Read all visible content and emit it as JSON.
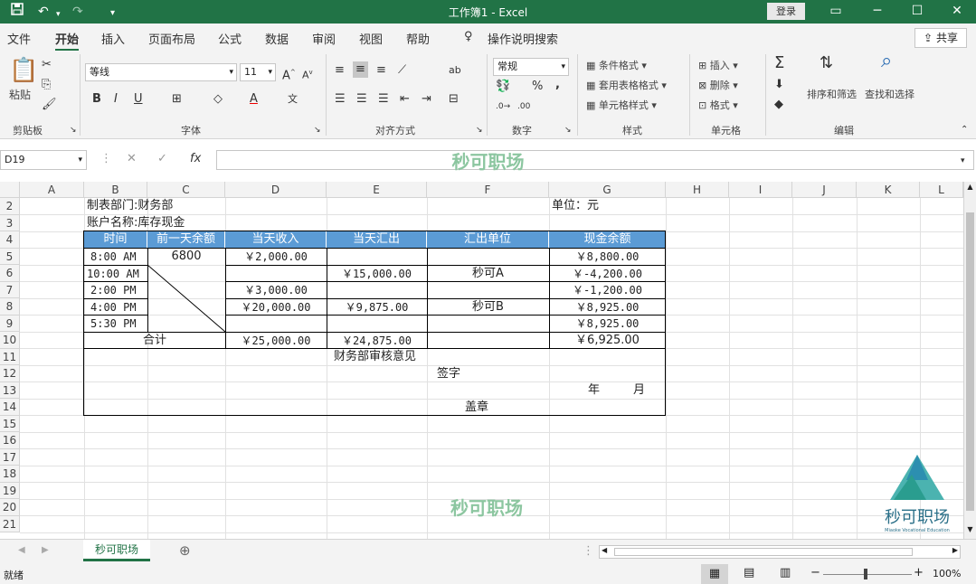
{
  "titlebar": {
    "title": "工作簿1  -  Excel",
    "login_label": "登录"
  },
  "menu": {
    "tabs": [
      "文件",
      "开始",
      "插入",
      "页面布局",
      "公式",
      "数据",
      "审阅",
      "视图",
      "帮助"
    ],
    "active_tab": "开始",
    "tell_me": "操作说明搜索",
    "share_label": "共享"
  },
  "ribbon": {
    "paste_label": "粘贴",
    "font_name": "等线",
    "font_size": "11",
    "number_format": "常规",
    "conditional_format": "条件格式",
    "format_as_table": "套用表格格式",
    "cell_styles": "单元格样式",
    "insert": "插入",
    "delete": "删除",
    "format": "格式",
    "sort_filter": "排序和筛选",
    "find_select": "查找和选择",
    "groups": {
      "clipboard": "剪贴板",
      "font": "字体",
      "alignment": "对齐方式",
      "number": "数字",
      "styles": "样式",
      "cells": "单元格",
      "editing": "编辑"
    },
    "bold": "B",
    "italic": "I",
    "underline": "U",
    "percent": "%",
    "comma": ","
  },
  "formula_bar": {
    "name_box": "D19",
    "fx": "fx",
    "watermark": "秒可职场"
  },
  "grid": {
    "columns": [
      "A",
      "B",
      "C",
      "D",
      "E",
      "F",
      "G",
      "H",
      "I",
      "J",
      "K",
      "L"
    ],
    "rows": [
      "2",
      "3",
      "4",
      "5",
      "6",
      "7",
      "8",
      "9",
      "10",
      "11",
      "12",
      "13",
      "14",
      "15",
      "16",
      "17",
      "18",
      "19",
      "20",
      "21"
    ],
    "dept_label": "制表部门:",
    "dept_value": "财务部",
    "unit_label": "单位：元",
    "account_label": "账户名称:",
    "account_value": "库存现金",
    "headers": [
      "时间",
      "前一天余额",
      "当天收入",
      "当天汇出",
      "汇出单位",
      "现金余额"
    ],
    "data_rows": [
      {
        "time": "8:00 AM",
        "prev": "6800",
        "income": "￥2,000.00",
        "out": "",
        "unit": "",
        "balance": "￥8,800.00"
      },
      {
        "time": "10:00 AM",
        "prev": "",
        "income": "",
        "out": "￥15,000.00",
        "unit": "秒可A",
        "balance": "￥-4,200.00"
      },
      {
        "time": "2:00 PM",
        "prev": "",
        "income": "￥3,000.00",
        "out": "",
        "unit": "",
        "balance": "￥-1,200.00"
      },
      {
        "time": "4:00 PM",
        "prev": "",
        "income": "￥20,000.00",
        "out": "￥9,875.00",
        "unit": "秒可B",
        "balance": "￥8,925.00"
      },
      {
        "time": "5:30 PM",
        "prev": "",
        "income": "",
        "out": "",
        "unit": "",
        "balance": "￥8,925.00"
      }
    ],
    "total_label": "合计",
    "total_income": "￥25,000.00",
    "total_out": "￥24,875.00",
    "total_balance": "￥6,925.00",
    "audit_title": "财务部审核意见",
    "sign_label": "签字",
    "year_label": "年",
    "month_label": "月",
    "seal_label": "盖章",
    "watermark": "秒可职场"
  },
  "logo": {
    "text": "秒可职场",
    "subtext": "Miaoke Vocational Education"
  },
  "sheets": {
    "tabs": [
      "秒可职场"
    ],
    "active": "秒可职场"
  },
  "status": {
    "ready": "就绪",
    "zoom": "100%"
  },
  "colors": {
    "excel_green": "#217346",
    "header_blue": "#5b9bd5",
    "watermark_green": "#8cc6a0"
  }
}
